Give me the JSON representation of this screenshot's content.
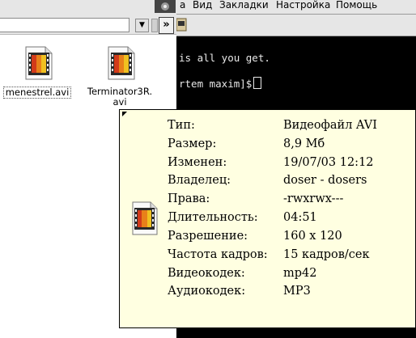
{
  "file_manager": {
    "files": [
      {
        "name": "menestrel.avi",
        "icon": "video-file-icon"
      },
      {
        "name": "Terminator3R.avi",
        "name_line1": "Terminator3R.",
        "name_line2": "avi",
        "icon": "video-file-icon"
      }
    ],
    "more_button": "»",
    "combo_arrow": "▼"
  },
  "terminal": {
    "menu": [
      "а",
      "Вид",
      "Закладки",
      "Настройка",
      "Помощь"
    ],
    "lines": [
      "is all you get.",
      "rtem maxim]$"
    ]
  },
  "tooltip": {
    "properties": [
      {
        "label": "Тип:",
        "value": "Видеофайл AVI"
      },
      {
        "label": "Размер:",
        "value": "8,9 Мб"
      },
      {
        "label": "Изменен:",
        "value": "19/07/03 12:12"
      },
      {
        "label": "Владелец:",
        "value": "doser - dosers"
      },
      {
        "label": "Права:",
        "value": "-rwxrwx---"
      },
      {
        "label": "Длительность:",
        "value": "04:51"
      },
      {
        "label": "Разрешение:",
        "value": "160 x 120"
      },
      {
        "label": "Частота кадров:",
        "value": "15 кадров/сек"
      },
      {
        "label": "Видеокодек:",
        "value": "mp42"
      },
      {
        "label": "Аудиокодек:",
        "value": "MP3"
      }
    ]
  },
  "colors": {
    "tooltip_bg": "#ffffe1",
    "terminal_bg": "#000000",
    "terminal_fg": "#e8e8e8"
  }
}
